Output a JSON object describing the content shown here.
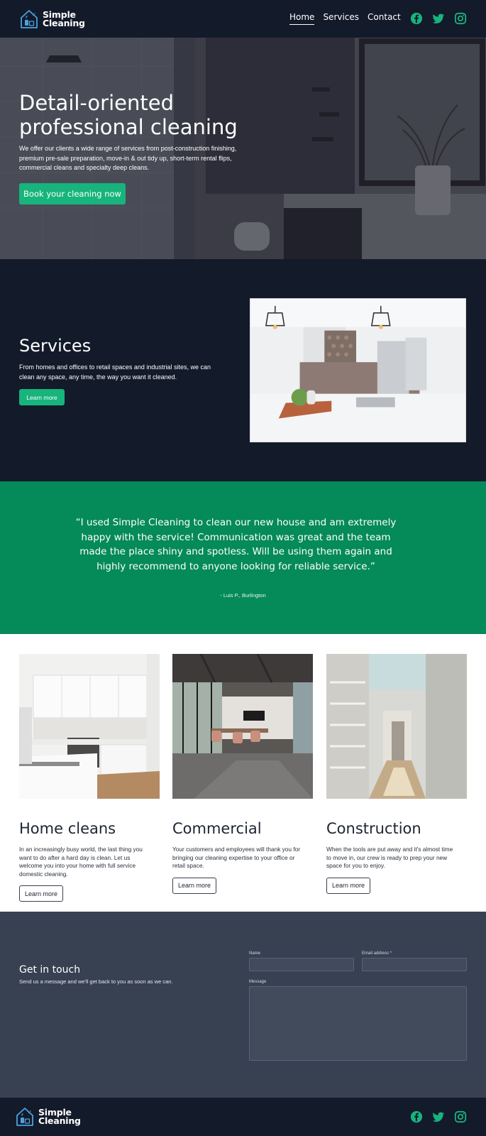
{
  "brand": {
    "name_line1": "Simple",
    "name_line2": "Cleaning",
    "accent_color": "#17b47c",
    "dark_color": "#131a2a"
  },
  "nav": {
    "items": [
      {
        "label": "Home",
        "active": true
      },
      {
        "label": "Services",
        "active": false
      },
      {
        "label": "Contact",
        "active": false
      }
    ]
  },
  "social": {
    "icons": [
      "facebook-icon",
      "twitter-icon",
      "instagram-icon"
    ]
  },
  "hero": {
    "title": "Detail-oriented professional cleaning",
    "description": "We offer our clients a wide range of services from post-construction finishing, premium pre-sale preparation, move-in & out tidy up, short-term rental flips, commercial cleans and specialty deep cleans.",
    "cta_label": "Book your cleaning now"
  },
  "services": {
    "title": "Services",
    "description": "From homes and offices to retail spaces and industrial sites, we can clean any space, any time, the way you want it cleaned.",
    "button_label": "Learn more"
  },
  "testimonial": {
    "quote": "“I used Simple Cleaning to clean our new house and am extremely happy with the service! Communication was great and the team made the place shiny and spotless. Will be using them again and highly recommend to anyone looking for reliable service.”",
    "author": "- Luis P., Burlington"
  },
  "cards": [
    {
      "title": "Home cleans",
      "description": "In an increasingly busy world, the last thing you want to do after a hard day is clean. Let us welcome you into your home with full service domestic cleaning.",
      "button_label": "Learn more"
    },
    {
      "title": "Commercial",
      "description": "Your customers and employees will thank you for bringing our cleaning expertise to your office or retail space.",
      "button_label": "Learn more"
    },
    {
      "title": "Construction",
      "description": "When the tools are put away and it's almost time to move in, our crew is ready to prep your new space for you to enjoy.",
      "button_label": "Learn more"
    }
  ],
  "contact": {
    "title": "Get in touch",
    "description": "Send us a message and we'll get back to you as soon as we can.",
    "name_label": "Name",
    "email_label": "Email address *",
    "message_label": "Message"
  }
}
